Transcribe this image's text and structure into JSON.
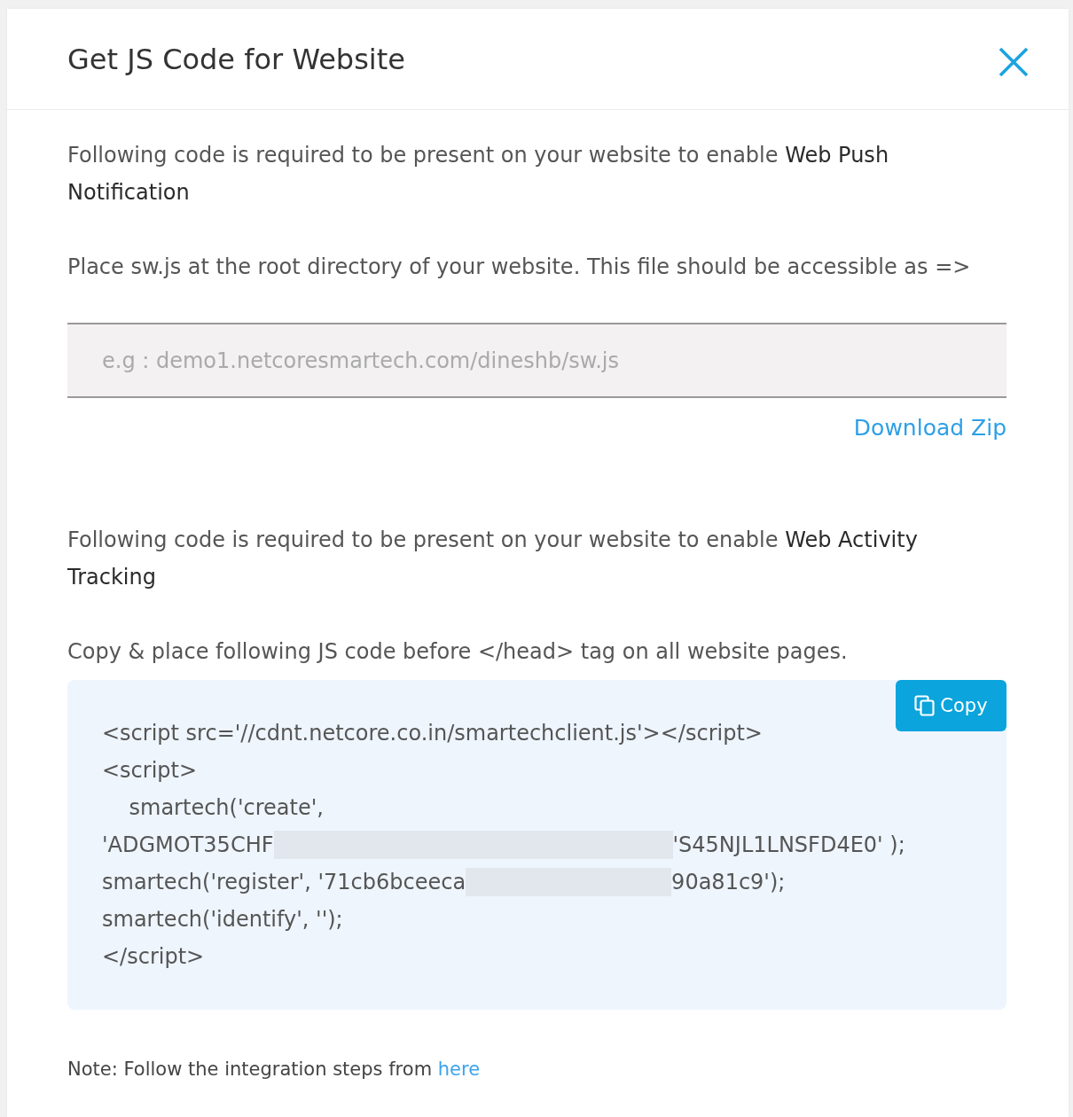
{
  "dialog": {
    "title": "Get JS Code for Website"
  },
  "push_section": {
    "intro": "Following code is required to be present on your website to enable **Web Push Notification**",
    "instruction": "Place sw.js at the root directory of your website. This file should be accessible as =>",
    "url_field": {
      "placeholder": "e.g : demo1.netcoresmartech.com/dineshb/sw.js"
    },
    "download_link": "Download Zip"
  },
  "activity_section": {
    "intro": "Following code is required to be present on your website to enable **Web Activity Tracking**",
    "instruction": "Copy & place following JS code before </head> tag on all website pages.",
    "copy_button": "Copy",
    "code_lines": [
      {
        "segments": [
          {
            "kind": "text",
            "text": "<script src='//cdnt.netcore.co.in/smartechclient.js'></script>"
          }
        ]
      },
      {
        "segments": [
          {
            "kind": "text",
            "text": "<script>"
          }
        ]
      },
      {
        "segments": [
          {
            "kind": "text",
            "text": "    smartech('create',"
          }
        ]
      },
      {
        "segments": [
          {
            "kind": "text",
            "text": "'ADGMOT35CHF"
          },
          {
            "kind": "redaction"
          },
          {
            "kind": "text",
            "text": "'S45NJL1LNSFD4E0' );"
          }
        ]
      },
      {
        "segments": [
          {
            "kind": "text",
            "text": "smartech('register', '71cb6bceeca"
          },
          {
            "kind": "redaction"
          },
          {
            "kind": "text",
            "text": "90a81c9');"
          }
        ]
      },
      {
        "segments": [
          {
            "kind": "text",
            "text": "smartech('identify', '');"
          }
        ]
      },
      {
        "segments": [
          {
            "kind": "text",
            "text": "</script>"
          }
        ]
      }
    ]
  },
  "note": {
    "text": "Note: Follow the integration steps from",
    "link": "here"
  }
}
